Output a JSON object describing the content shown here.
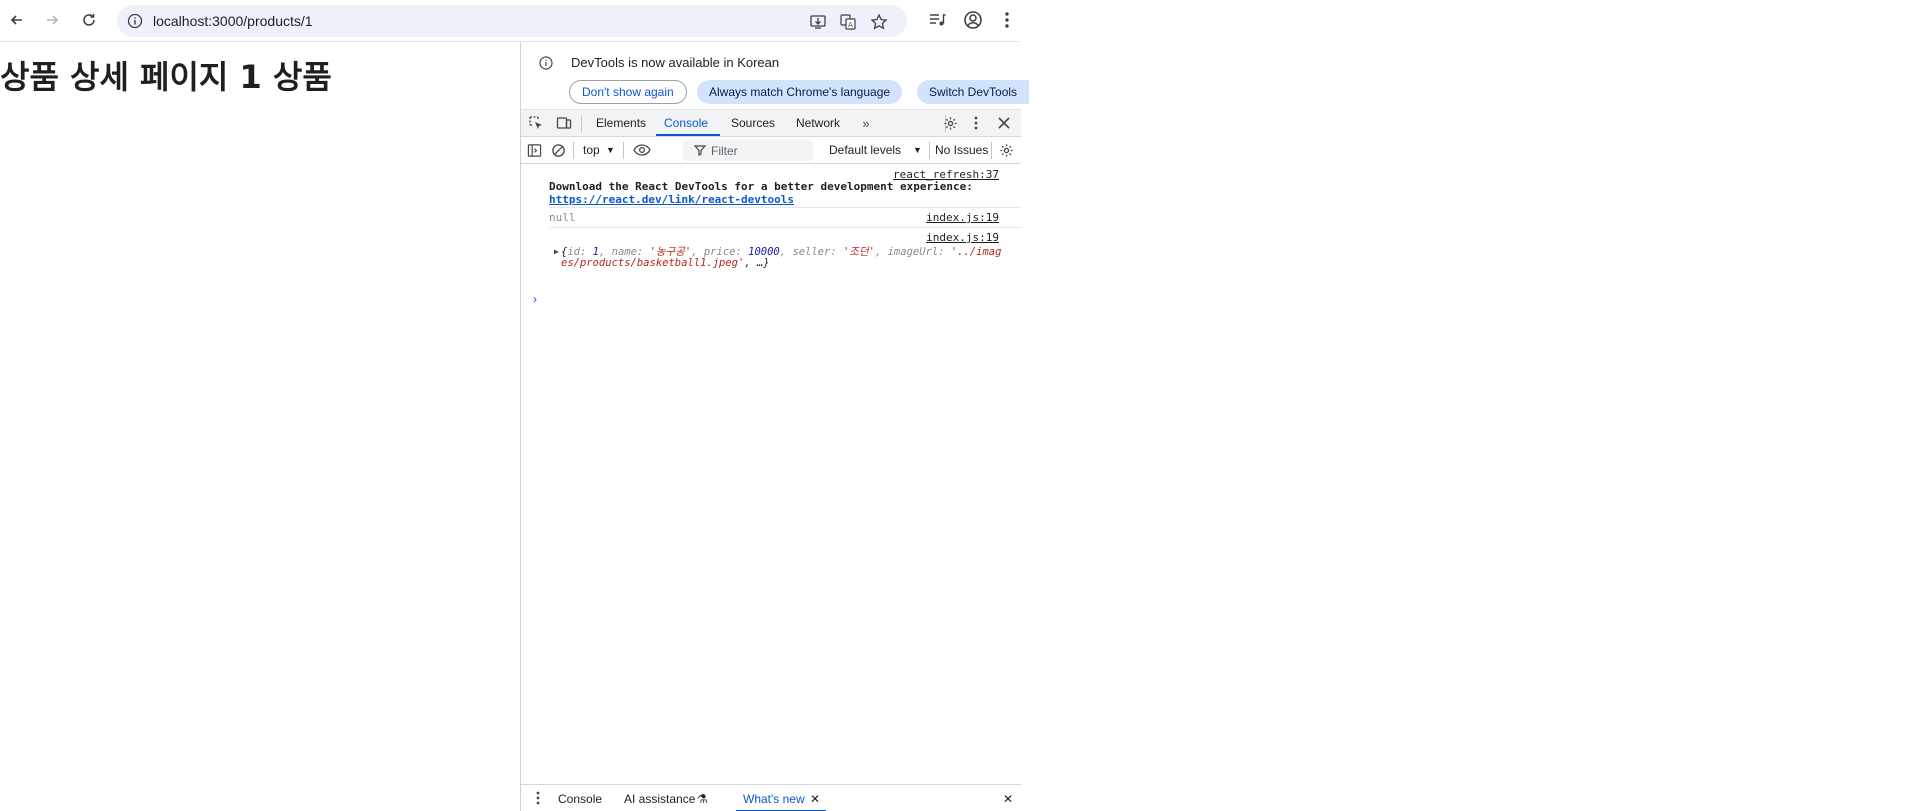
{
  "browser": {
    "back_icon": "arrow-left",
    "forward_icon": "arrow-right",
    "reload_icon": "reload",
    "url": "localhost:3000/products/1"
  },
  "page": {
    "heading": "상품 상세 페이지 1 상품"
  },
  "devtools": {
    "infobar": {
      "message": "DevTools is now available in Korean",
      "dont_show": "Don't show again",
      "always_match": "Always match Chrome's language",
      "switch": "Switch DevTools"
    },
    "tabs": [
      "Elements",
      "Console",
      "Sources",
      "Network"
    ],
    "active_tab": "Console",
    "console_toolbar": {
      "context": "top",
      "filter_placeholder": "Filter",
      "levels": "Default levels",
      "issues": "No Issues"
    },
    "messages": {
      "m1_source": "react_refresh:37",
      "m1_text": "Download the React DevTools for a better development experience:",
      "m1_link": "https://react.dev/link/react-devtools",
      "m2_source": "index.js:19",
      "m2_text": "null",
      "m3_source": "index.js:19",
      "m3_obj": {
        "open": "{",
        "id_key": "id",
        "id_val": "1",
        "name_key": "name",
        "name_val": "'농구공'",
        "price_key": "price",
        "price_val": "10000",
        "seller_key": "seller",
        "seller_val": "'조던'",
        "imageUrl_key": "imageUrl",
        "imageUrl_val1": "'../imag",
        "imageUrl_val2": "es/products/basketball1.jpeg'",
        "tail": ", …}"
      }
    },
    "drawer": {
      "console": "Console",
      "ai": "AI assistance",
      "whats_new": "What's new"
    }
  },
  "colors": {
    "accent": "#0b57d0",
    "pill_filled": "#d3e3fd",
    "omnibox": "#edf2fa"
  }
}
